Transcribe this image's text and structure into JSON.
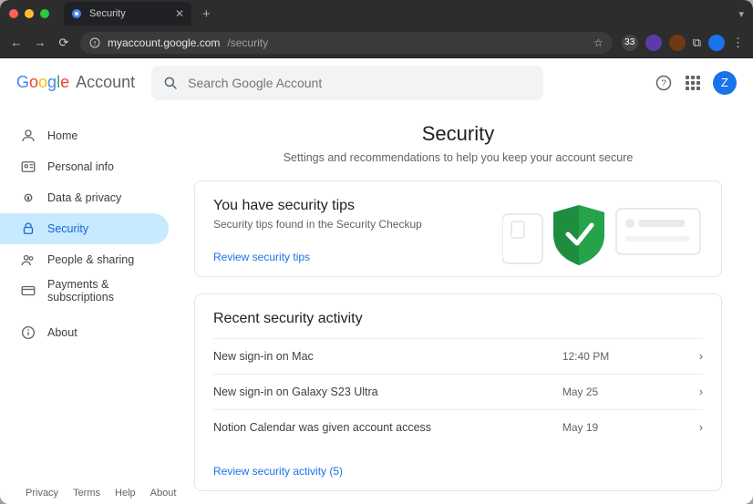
{
  "browser": {
    "tab_title": "Security",
    "url_host": "myaccount.google.com",
    "url_path": "/security"
  },
  "header": {
    "logo_brand": "Google",
    "logo_suffix": "Account",
    "search_placeholder": "Search Google Account",
    "avatar_initial": "Z"
  },
  "sidebar": {
    "items": [
      {
        "icon": "home",
        "label": "Home"
      },
      {
        "icon": "idcard",
        "label": "Personal info"
      },
      {
        "icon": "privacy",
        "label": "Data & privacy"
      },
      {
        "icon": "lock",
        "label": "Security",
        "active": true
      },
      {
        "icon": "people",
        "label": "People & sharing"
      },
      {
        "icon": "card",
        "label": "Payments & subscriptions"
      }
    ],
    "about_label": "About"
  },
  "page": {
    "title": "Security",
    "subtitle": "Settings and recommendations to help you keep your account secure"
  },
  "tips": {
    "heading": "You have security tips",
    "desc": "Security tips found in the Security Checkup",
    "link": "Review security tips"
  },
  "recent": {
    "heading": "Recent security activity",
    "rows": [
      {
        "text": "New sign-in on Mac",
        "time": "12:40 PM"
      },
      {
        "text": "New sign-in on Galaxy S23 Ultra",
        "time": "May 25"
      },
      {
        "text": "Notion Calendar was given account access",
        "time": "May 19"
      }
    ],
    "link": "Review security activity (5)"
  },
  "footer": {
    "links": [
      "Privacy",
      "Terms",
      "Help",
      "About"
    ]
  },
  "colors": {
    "accent_blue": "#1a73e8",
    "shield_green": "#1e8e3e"
  }
}
